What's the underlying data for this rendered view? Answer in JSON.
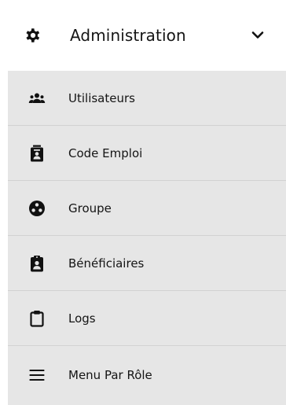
{
  "menu": {
    "header": {
      "title": "Administration",
      "icon": "gear-icon",
      "toggle_icon": "chevron-down-icon"
    },
    "items": [
      {
        "label": "Utilisateurs",
        "icon": "users-icon"
      },
      {
        "label": "Code Emploi",
        "icon": "id-badge-icon"
      },
      {
        "label": "Groupe",
        "icon": "group-circle-icon"
      },
      {
        "label": "Bénéficiaires",
        "icon": "clipboard-user-icon"
      },
      {
        "label": "Logs",
        "icon": "clipboard-icon"
      },
      {
        "label": "Menu Par Rôle",
        "icon": "bars-icon"
      }
    ],
    "colors": {
      "submenu_background": "#e6e6e6",
      "separator": "#d2d2d2",
      "text": "#111111"
    }
  }
}
